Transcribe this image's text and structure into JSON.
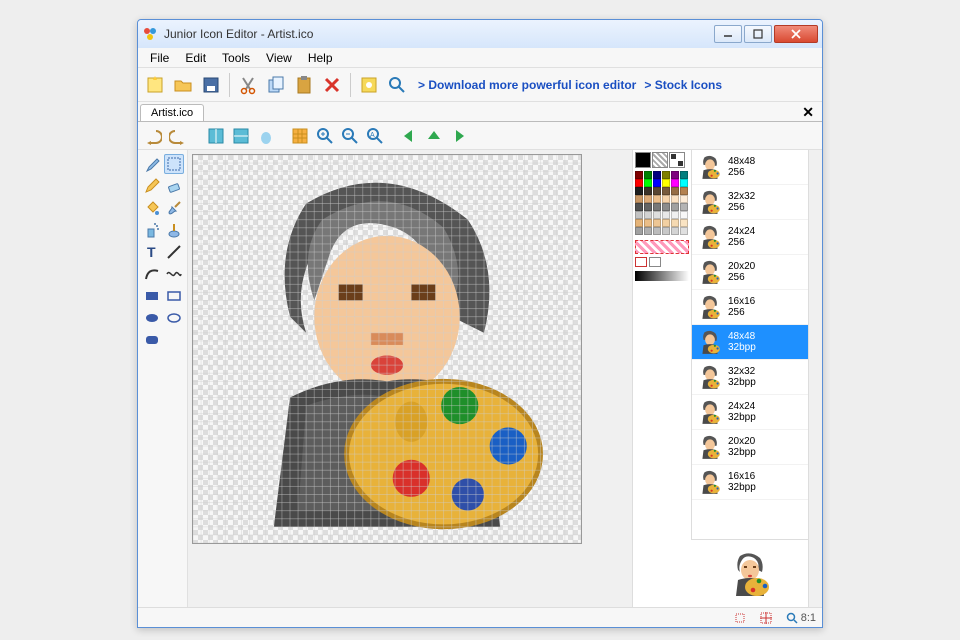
{
  "window": {
    "title": "Junior Icon Editor - Artist.ico"
  },
  "menu": [
    "File",
    "Edit",
    "Tools",
    "View",
    "Help"
  ],
  "toolbar_links": {
    "download": "> Download more powerful icon editor",
    "stock": "> Stock Icons"
  },
  "tab": {
    "name": "Artist.ico"
  },
  "colors": {
    "foreground": "#000000",
    "background": "transparent",
    "basic": [
      "#7f0000",
      "#007f00",
      "#00007f",
      "#7f7f00",
      "#7f007f",
      "#007f7f",
      "#ff0000",
      "#00ff00",
      "#0000ff",
      "#ffff00",
      "#ff00ff",
      "#00ffff"
    ],
    "gray_rows": 30
  },
  "sizes": [
    {
      "dim": "48x48",
      "depth": "256"
    },
    {
      "dim": "32x32",
      "depth": "256"
    },
    {
      "dim": "24x24",
      "depth": "256"
    },
    {
      "dim": "20x20",
      "depth": "256"
    },
    {
      "dim": "16x16",
      "depth": "256"
    },
    {
      "dim": "48x48",
      "depth": "32bpp",
      "selected": true
    },
    {
      "dim": "32x32",
      "depth": "32bpp"
    },
    {
      "dim": "24x24",
      "depth": "32bpp"
    },
    {
      "dim": "20x20",
      "depth": "32bpp"
    },
    {
      "dim": "16x16",
      "depth": "32bpp"
    }
  ],
  "status": {
    "zoom": "8:1"
  },
  "tool_icons": [
    "undo",
    "redo",
    "flip-h",
    "flip-v",
    "blur",
    "grid",
    "zoom-in",
    "zoom-out",
    "zoom-fit",
    "nav-left",
    "nav-up",
    "nav-right"
  ],
  "main_toolbar_icons": [
    "new",
    "open",
    "save",
    "cut",
    "copy",
    "paste",
    "delete",
    "color",
    "magnify"
  ],
  "tools": [
    "eyedropper",
    "marquee",
    "pencil",
    "eraser",
    "fill",
    "brush",
    "spray",
    "clone",
    "text",
    "line",
    "curve",
    "wave",
    "rect-filled",
    "rect",
    "ellipse-filled",
    "ellipse",
    "rounded-filled"
  ]
}
